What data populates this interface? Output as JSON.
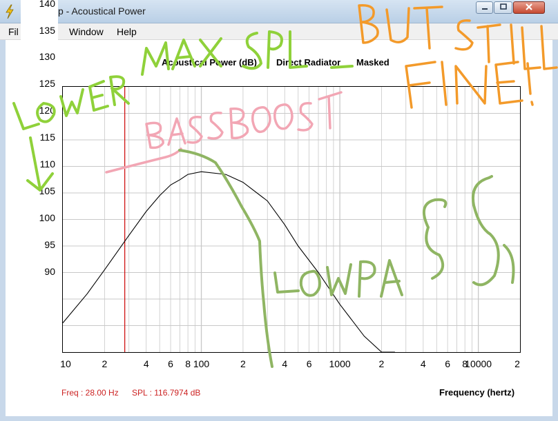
{
  "window": {
    "title": "p - Acoustical Power",
    "buttons": {
      "minimize": "minimize-icon",
      "maximize": "maximize-icon",
      "close": "close-icon"
    }
  },
  "menu": [
    "Fil",
    "Window",
    "Help"
  ],
  "legend": {
    "item1": "Acoustical Power (dB)",
    "item2": "Direct Radiator",
    "item3": "Masked"
  },
  "colors": {
    "curve": "#000000",
    "marker": "#cc0000",
    "grid": "#c8c8c8",
    "annotation_green": "#8fd13a",
    "annotation_pink": "#f2a6b4",
    "annotation_orange": "#f39a2a",
    "lowpass_green": "#8fb563"
  },
  "status": {
    "freq": "Freq : 28.00 Hz",
    "spl": "SPL : 116.7974 dB"
  },
  "chart_data": {
    "type": "line",
    "xlabel": "Frequency (hertz)",
    "ylabel": "",
    "xscale": "log",
    "xlim": [
      10,
      20000
    ],
    "ylim": [
      80,
      130
    ],
    "yticks_left": [
      "140",
      "135",
      "130",
      "125",
      "120",
      "115",
      "110",
      "105",
      "100",
      "95",
      "90"
    ],
    "xticks": [
      "10",
      "2",
      "4",
      "6",
      "8",
      "100",
      "2",
      "4",
      "6",
      "1000",
      "2",
      "4",
      "6",
      "8",
      "10000",
      "2"
    ],
    "marker_x": 28,
    "series": [
      {
        "x": [
          10,
          15,
          20,
          30,
          40,
          50,
          60,
          70,
          80,
          100,
          150,
          200,
          300,
          400,
          500,
          700,
          1000,
          1500,
          2000,
          2500
        ],
        "y": [
          85.5,
          91,
          95.5,
          102,
          106.5,
          109.5,
          111.5,
          112.5,
          113.5,
          114,
          113.5,
          112,
          108.5,
          104,
          100,
          95,
          89,
          83,
          80,
          77.5
        ]
      }
    ]
  },
  "annotations": {
    "lower_max_spl": "LOWER MAX SPL",
    "bass_boost": "BASSBOOST",
    "but_still_fine": [
      "BUT STILL",
      "FINE!"
    ],
    "lowpass": "LOWPASS"
  }
}
